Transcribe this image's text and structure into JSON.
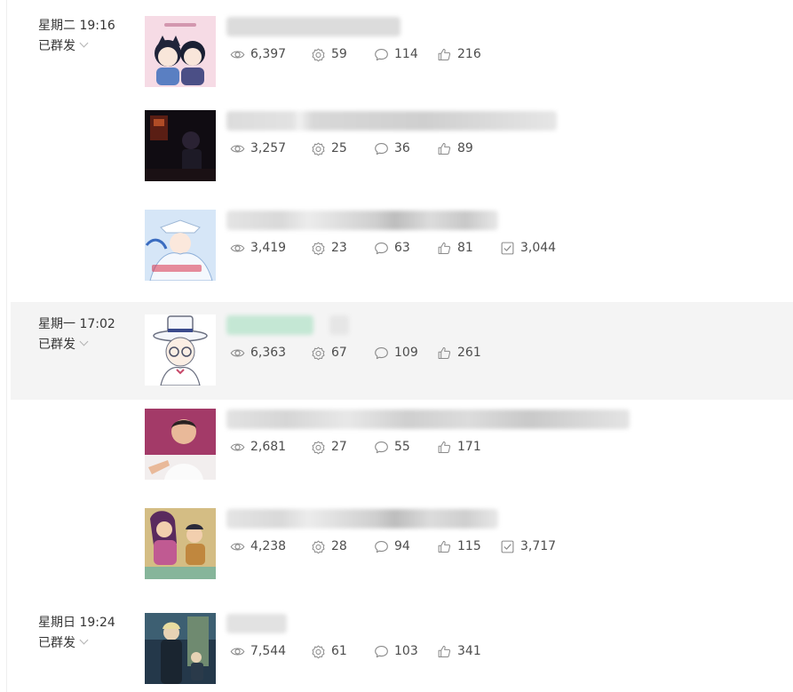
{
  "groups": [
    {
      "day_time": "星期二 19:16",
      "status": "已群发"
    },
    {
      "day_time": "星期一 17:02",
      "status": "已群发"
    },
    {
      "day_time": "星期日 19:24",
      "status": "已群发"
    }
  ],
  "articles": [
    {
      "views": "6,397",
      "shares": "59",
      "comments": "114",
      "likes": "216"
    },
    {
      "views": "3,257",
      "shares": "25",
      "comments": "36",
      "likes": "89"
    },
    {
      "views": "3,419",
      "shares": "23",
      "comments": "63",
      "likes": "81",
      "reads": "3,044"
    },
    {
      "views": "6,363",
      "shares": "67",
      "comments": "109",
      "likes": "261"
    },
    {
      "views": "2,681",
      "shares": "27",
      "comments": "55",
      "likes": "171"
    },
    {
      "views": "4,238",
      "shares": "28",
      "comments": "94",
      "likes": "115",
      "reads": "3,717"
    },
    {
      "views": "7,544",
      "shares": "61",
      "comments": "103",
      "likes": "341"
    }
  ],
  "icons": {
    "views": "eye-icon",
    "shares": "share-gear-icon",
    "comments": "comment-bubble-icon",
    "likes": "thumbs-up-icon",
    "reads": "checkbox-icon",
    "expand": "chevron-down-icon"
  },
  "colors": {
    "stat_text": "#4d4d4d",
    "icon": "#8a8a8a",
    "group_band": "#f4f4f4",
    "date_text": "#353535"
  }
}
